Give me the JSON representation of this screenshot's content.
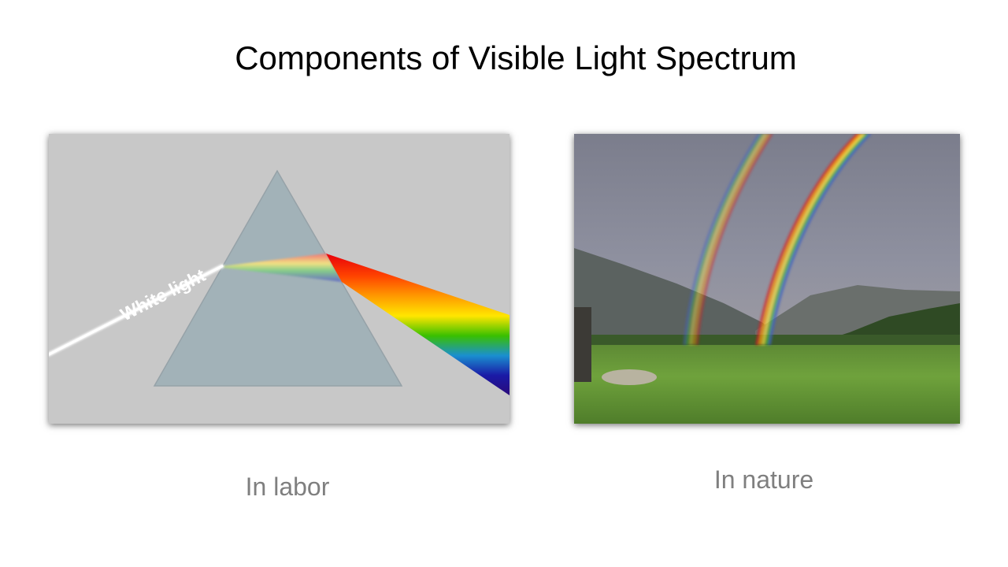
{
  "slide": {
    "title": "Components of Visible Light Spectrum"
  },
  "prism_illustration": {
    "beam_label": "White light",
    "caption": "In labor",
    "colors": {
      "background": "#c8c8c8",
      "prism": "#a2b2b8",
      "spectrum": [
        "#e8000b",
        "#ff7f00",
        "#ffe600",
        "#2fb800",
        "#1b7bd6",
        "#1a1aa6",
        "#3a0f8c"
      ]
    }
  },
  "rainbow_photo": {
    "caption": "In nature"
  }
}
